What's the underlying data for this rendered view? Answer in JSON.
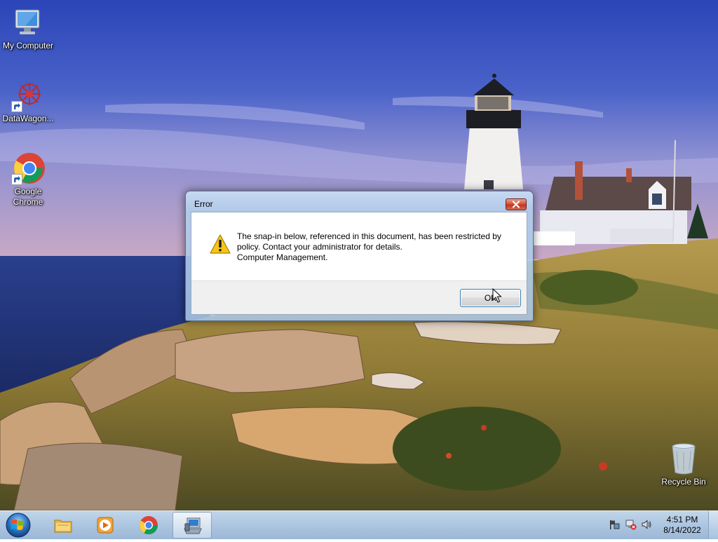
{
  "desktop": {
    "icons": [
      {
        "label": "My Computer",
        "icon": "computer-icon"
      },
      {
        "label": "DataWagon...",
        "icon": "datawagon-icon"
      },
      {
        "label": "Google Chrome",
        "icon": "chrome-icon"
      },
      {
        "label": "Recycle Bin",
        "icon": "recycle-bin-icon"
      }
    ]
  },
  "dialog": {
    "title": "Error",
    "message_lines": [
      "The snap-in below, referenced in this document, has been restricted by",
      "policy. Contact your administrator for details.",
      "Computer Management."
    ],
    "ok_label": "OK",
    "icon": "warning-icon",
    "close_icon": "close-icon"
  },
  "taskbar": {
    "start_icon": "windows-start-icon",
    "items": [
      {
        "name": "file-explorer",
        "icon": "folder-icon",
        "active": false
      },
      {
        "name": "media-player",
        "icon": "media-player-icon",
        "active": false
      },
      {
        "name": "chrome",
        "icon": "chrome-icon",
        "active": false
      },
      {
        "name": "computer-management",
        "icon": "computer-management-icon",
        "active": true
      }
    ],
    "tray": [
      "action-center-flag-icon",
      "network-error-icon",
      "volume-icon"
    ],
    "clock": {
      "time": "4:51 PM",
      "date": "8/14/2022"
    }
  },
  "colors": {
    "close_button": "#c3351f",
    "ok_border": "#3c7fb1",
    "dialog_frame": "#b2cdeb",
    "taskbar": "#aac4e0"
  }
}
